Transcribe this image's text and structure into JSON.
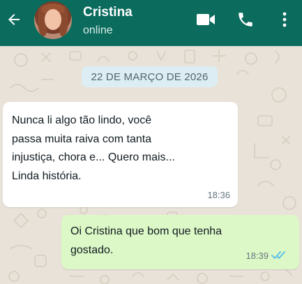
{
  "header": {
    "contact_name": "Cristina",
    "status": "online",
    "icons": {
      "back": "arrow-left-icon",
      "video": "video-camera-icon",
      "call": "phone-icon",
      "menu": "more-vertical-icon"
    },
    "background_color": "#0b6b5d"
  },
  "chat": {
    "date_label": "22 DE MARÇO DE 2026",
    "messages": [
      {
        "direction": "incoming",
        "text": "Nunca li algo tão lindo, você passa muita raiva com tanta injustiça, chora e... Quero mais... Linda história.",
        "time": "18:36"
      },
      {
        "direction": "outgoing",
        "text": "Oi Cristina que bom que tenha gostado.",
        "time": "18:39",
        "status_icon": "double-check-read-icon"
      }
    ],
    "colors": {
      "incoming_bubble": "#ffffff",
      "outgoing_bubble": "#dcf8c6",
      "read_ticks": "#53bdeb",
      "wallpaper": "#e9e2d8"
    }
  }
}
